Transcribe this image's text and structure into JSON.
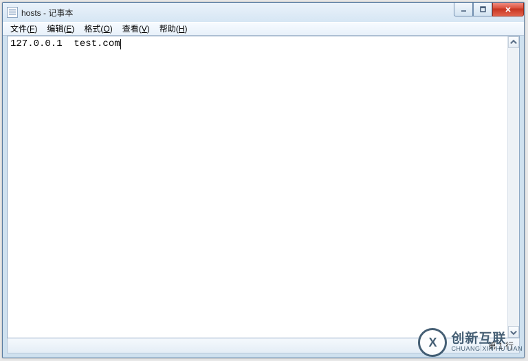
{
  "window": {
    "title": "hosts - 记事本"
  },
  "menu": {
    "file": {
      "label": "文件",
      "accel": "F"
    },
    "edit": {
      "label": "编辑",
      "accel": "E"
    },
    "format": {
      "label": "格式",
      "accel": "O"
    },
    "view": {
      "label": "查看",
      "accel": "V"
    },
    "help": {
      "label": "帮助",
      "accel": "H"
    }
  },
  "editor": {
    "content": "127.0.0.1  test.com"
  },
  "statusbar": {
    "position": "第 1 行"
  },
  "watermark": {
    "logo": "X",
    "cn": "创新互联",
    "en": "CHUANG XIN HU LIAN"
  }
}
